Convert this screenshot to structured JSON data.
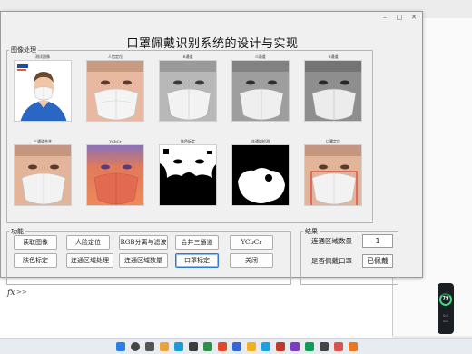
{
  "window": {
    "title": "口罩佩戴识别系统的设计与实现",
    "min_glyph": "–",
    "max_glyph": "□",
    "close_glyph": "✕"
  },
  "panels": {
    "image_panel_title": "图像处理",
    "func_panel_title": "功能",
    "result_panel_title": "结果"
  },
  "tiles": [
    {
      "caption": "测试图像"
    },
    {
      "caption": "人脸定位"
    },
    {
      "caption": "R通道"
    },
    {
      "caption": "G通道"
    },
    {
      "caption": "B通道"
    },
    {
      "caption": "三通道合并"
    },
    {
      "caption": "YCbCr"
    },
    {
      "caption": "肤色标定"
    },
    {
      "caption": "连通域检测"
    },
    {
      "caption": "口罩定位"
    }
  ],
  "buttons": {
    "read_image": "读取图像",
    "face_locate": "人脸定位",
    "rgb_split": "RGB分离与滤波",
    "merge_channels": "合并三通道",
    "ycbcr": "YCbCr",
    "skin_mark": "肤色标定",
    "region_process": "连通区域处理",
    "region_count": "连通区域数量",
    "mask_locate": "口罩标定",
    "close": "关闭"
  },
  "results": {
    "count_label": "连通区域数量",
    "count_value": "1",
    "mask_label": "是否佩戴口罩",
    "mask_value": "已佩戴"
  },
  "background": {
    "cmd_fx": "fx",
    "cmd_prompt": ">>"
  },
  "widget": {
    "percent": "79",
    "line1": "0.0",
    "line2": "0.0"
  },
  "taskbar": {
    "time": "",
    "date": ""
  },
  "colors": {
    "accent": "#2f7ad8",
    "skin": "#e8b9a0",
    "mask_white": "#f4f4f4"
  }
}
